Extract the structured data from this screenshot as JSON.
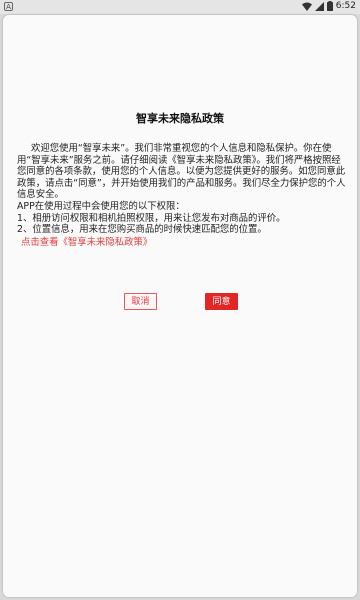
{
  "status_bar": {
    "notification_glyph": "A",
    "time": "6:52",
    "icons": [
      "wifi-icon",
      "signal-icon",
      "battery-icon"
    ]
  },
  "dialog": {
    "title": "智享未来隐私政策",
    "paragraph_1": "欢迎您使用“智享未来”。我们非常重视您的个人信息和隐私保护。你在使用“智享未来”服务之前。请仔细阅读《智享未来隐私政策》。我们将严格按照经您同意的各项条款，使用您的个人信息。以便为您提供更好的服务。如您同意此政策，请点击“同意”，并开始使用我们的产品和服务。我们尽全力保护您的个人信息安全。",
    "permissions_intro": "APP在使用过程中会使用您的以下权限：",
    "permission_1": "1、相册访问权限和相机拍照权限，用来让您发布对商品的评价。",
    "permission_2": "2、位置信息，用来在您购买商品的时候快速匹配您的位置。",
    "policy_link": "点击查看《智享未来隐私政策》",
    "cancel_label": "取消",
    "agree_label": "同意"
  },
  "colors": {
    "accent": "#e22626",
    "link": "#e33b3b",
    "background": "#fafafa",
    "backdrop": "#d9d9d9"
  }
}
